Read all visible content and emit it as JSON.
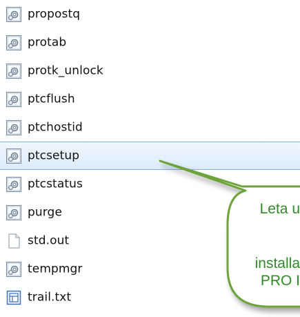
{
  "files": [
    {
      "name": "propostq",
      "icon": "executable-icon",
      "selected": false
    },
    {
      "name": "protab",
      "icon": "executable-icon",
      "selected": false
    },
    {
      "name": "protk_unlock",
      "icon": "executable-icon",
      "selected": false
    },
    {
      "name": "ptcflush",
      "icon": "executable-icon",
      "selected": false
    },
    {
      "name": "ptchostid",
      "icon": "executable-icon",
      "selected": false
    },
    {
      "name": "ptcsetup",
      "icon": "executable-icon",
      "selected": true
    },
    {
      "name": "ptcstatus",
      "icon": "executable-icon",
      "selected": false
    },
    {
      "name": "purge",
      "icon": "executable-icon",
      "selected": false
    },
    {
      "name": "std.out",
      "icon": "blank-file-icon",
      "selected": false
    },
    {
      "name": "tempmgr",
      "icon": "executable-icon",
      "selected": false
    },
    {
      "name": "trail.txt",
      "icon": "trail-file-icon",
      "selected": false
    }
  ],
  "callout": {
    "lines": [
      "Leta u",
      "",
      "installa",
      "PRO I"
    ],
    "text_color": "#2f8a27",
    "border_color": "#6ea23a"
  },
  "colors": {
    "selection_border": "#84acdd",
    "selection_fill": "#dcebfc"
  }
}
